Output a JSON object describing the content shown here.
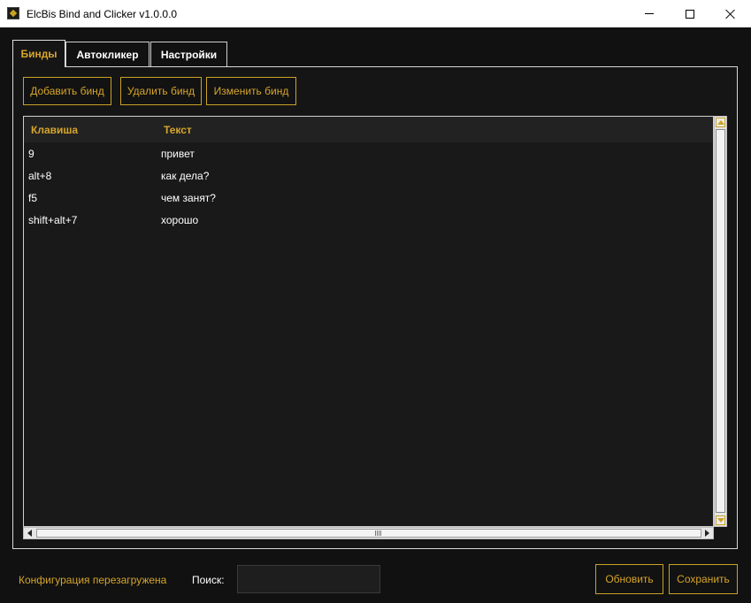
{
  "window": {
    "title": "ElcBis Bind and Clicker v1.0.0.0"
  },
  "tabs": [
    {
      "label": "Бинды",
      "active": true
    },
    {
      "label": "Автокликер",
      "active": false
    },
    {
      "label": "Настройки",
      "active": false
    }
  ],
  "toolbar": {
    "add_label": "Добавить бинд",
    "delete_label": "Удалить бинд",
    "edit_label": "Изменить бинд"
  },
  "table": {
    "columns": [
      "Клавиша",
      "Текст"
    ],
    "rows": [
      {
        "key": "9",
        "text": "привет"
      },
      {
        "key": "alt+8",
        "text": "как дела?"
      },
      {
        "key": "f5",
        "text": "чем занят?"
      },
      {
        "key": "shift+alt+7",
        "text": "хорошо"
      }
    ]
  },
  "footer": {
    "status": "Конфигурация перезагружена",
    "search_label": "Поиск:",
    "search_value": "",
    "refresh_label": "Обновить",
    "save_label": "Сохранить"
  },
  "colors": {
    "accent": "#d6a52b",
    "background": "#111111",
    "panel": "#151515"
  }
}
